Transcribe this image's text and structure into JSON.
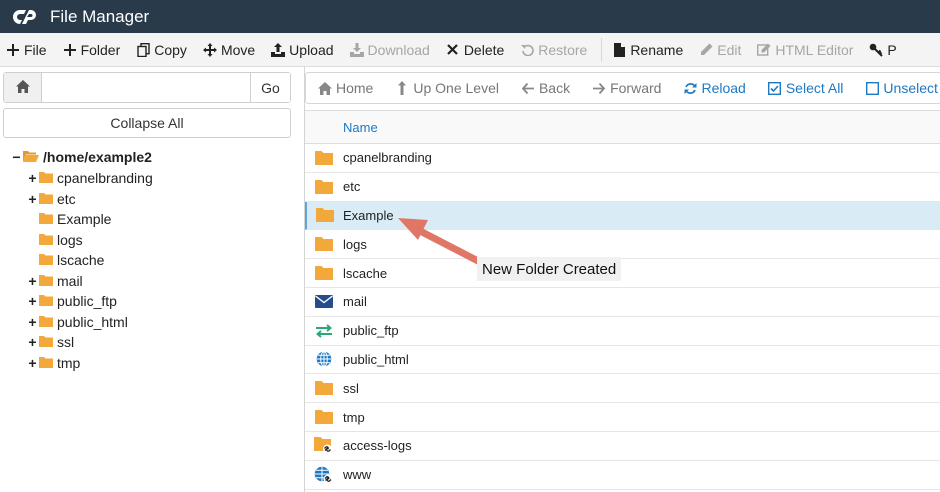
{
  "app": {
    "title": "File Manager"
  },
  "toolbar": {
    "items": [
      {
        "label": "File",
        "icon": "plus-icon",
        "enabled": true
      },
      {
        "label": "Folder",
        "icon": "plus-icon",
        "enabled": true
      },
      {
        "label": "Copy",
        "icon": "copy-icon",
        "enabled": true
      },
      {
        "label": "Move",
        "icon": "move-icon",
        "enabled": true
      },
      {
        "label": "Upload",
        "icon": "upload-icon",
        "enabled": true
      },
      {
        "label": "Download",
        "icon": "download-icon",
        "enabled": false
      },
      {
        "label": "Delete",
        "icon": "close-icon",
        "enabled": true
      },
      {
        "label": "Restore",
        "icon": "undo-icon",
        "enabled": false
      },
      {
        "label": "Rename",
        "icon": "file-icon",
        "enabled": true
      },
      {
        "label": "Edit",
        "icon": "pencil-icon",
        "enabled": false
      },
      {
        "label": "HTML Editor",
        "icon": "edit-box-icon",
        "enabled": false
      },
      {
        "label": "P",
        "icon": "key-icon",
        "enabled": true
      }
    ]
  },
  "left": {
    "path_placeholder": "",
    "go_label": "Go",
    "collapse_label": "Collapse All",
    "tree": {
      "root": {
        "label": "/home/example2",
        "toggle": "−"
      },
      "items": [
        {
          "label": "cpanelbranding",
          "toggle": "+"
        },
        {
          "label": "etc",
          "toggle": "+"
        },
        {
          "label": "Example",
          "toggle": ""
        },
        {
          "label": "logs",
          "toggle": ""
        },
        {
          "label": "lscache",
          "toggle": ""
        },
        {
          "label": "mail",
          "toggle": "+"
        },
        {
          "label": "public_ftp",
          "toggle": "+"
        },
        {
          "label": "public_html",
          "toggle": "+"
        },
        {
          "label": "ssl",
          "toggle": "+"
        },
        {
          "label": "tmp",
          "toggle": "+"
        }
      ]
    }
  },
  "nav": {
    "items": [
      {
        "label": "Home",
        "icon": "home-icon",
        "active": false
      },
      {
        "label": "Up One Level",
        "icon": "level-up-icon",
        "active": false
      },
      {
        "label": "Back",
        "icon": "arrow-left-icon",
        "active": false
      },
      {
        "label": "Forward",
        "icon": "arrow-right-icon",
        "active": false
      },
      {
        "label": "Reload",
        "icon": "reload-icon",
        "active": true
      },
      {
        "label": "Select All",
        "icon": "checkbox-checked-icon",
        "active": true
      },
      {
        "label": "Unselect All",
        "icon": "checkbox-empty-icon",
        "active": true
      }
    ]
  },
  "table": {
    "header": "Name",
    "rows": [
      {
        "name": "cpanelbranding",
        "icon": "folder-icon"
      },
      {
        "name": "etc",
        "icon": "folder-icon"
      },
      {
        "name": "Example",
        "icon": "folder-icon",
        "selected": true
      },
      {
        "name": "logs",
        "icon": "folder-icon"
      },
      {
        "name": "lscache",
        "icon": "folder-icon"
      },
      {
        "name": "mail",
        "icon": "envelope-icon"
      },
      {
        "name": "public_ftp",
        "icon": "exchange-icon"
      },
      {
        "name": "public_html",
        "icon": "globe-icon"
      },
      {
        "name": "ssl",
        "icon": "folder-icon"
      },
      {
        "name": "tmp",
        "icon": "folder-icon"
      },
      {
        "name": "access-logs",
        "icon": "folder-link-icon"
      },
      {
        "name": "www",
        "icon": "globe-link-icon"
      }
    ]
  },
  "annotation": {
    "text": "New Folder Created"
  },
  "colors": {
    "titlebar": "#293a4a",
    "folder": "#f3a83b",
    "link": "#1e78c2",
    "selected_row": "#d9ecf6",
    "arrow": "#e07766"
  }
}
